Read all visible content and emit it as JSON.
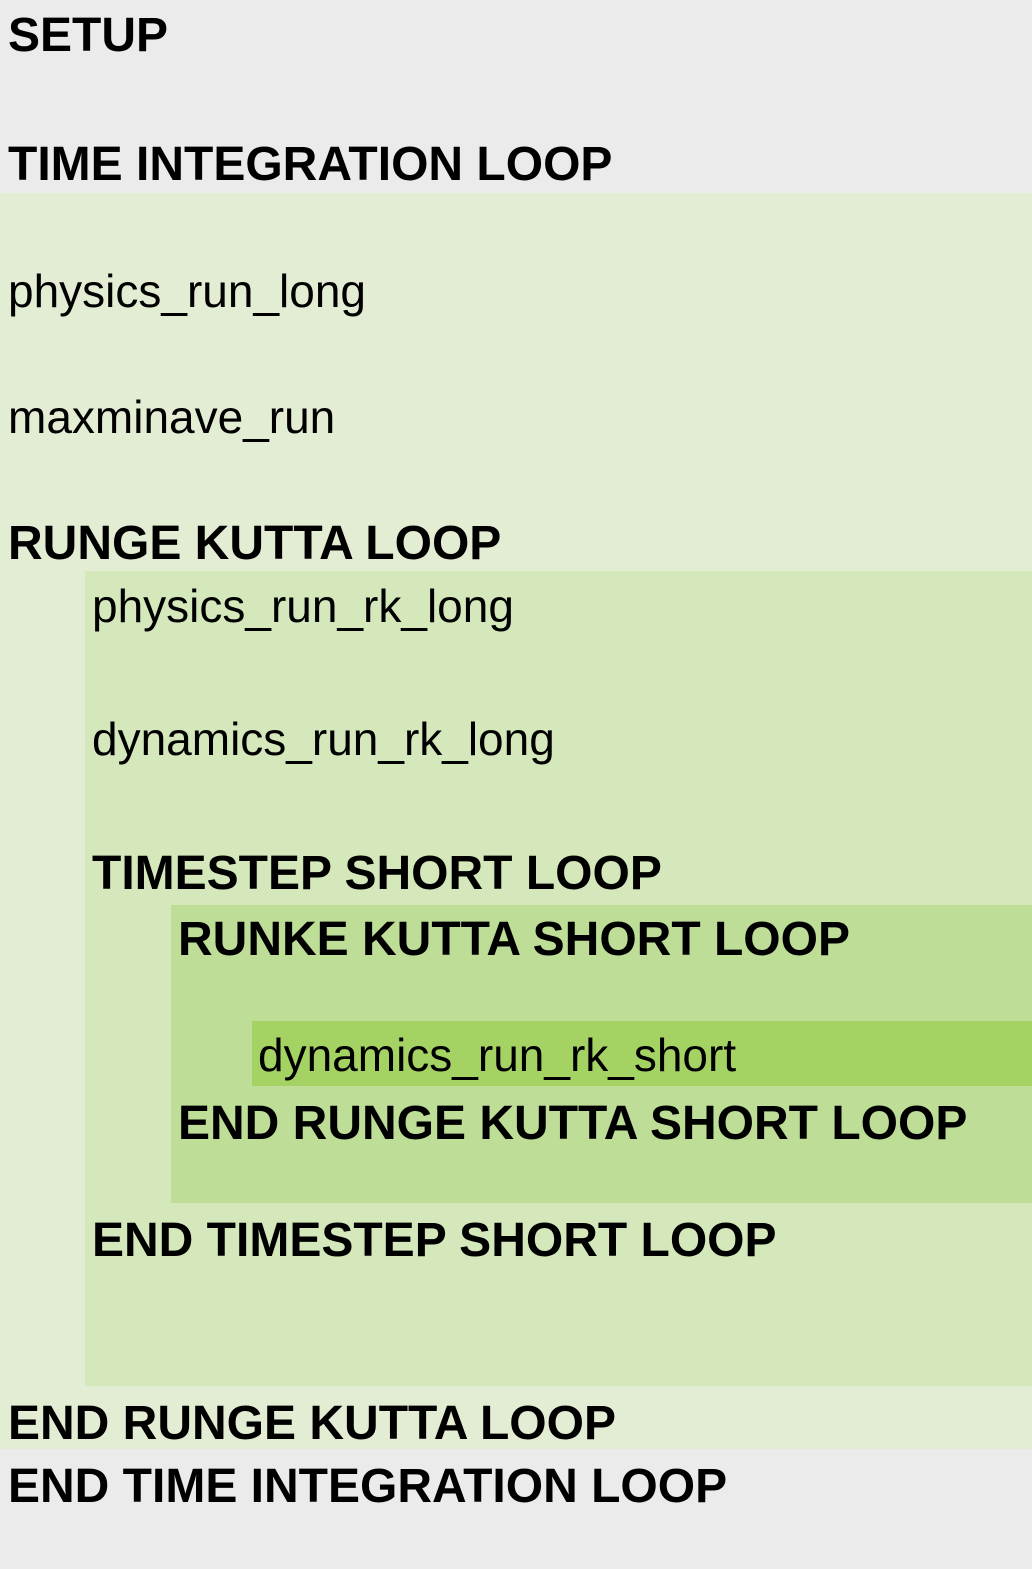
{
  "lines": {
    "setup": "SETUP",
    "time_loop": "TIME INTEGRATION LOOP",
    "physics_run_long": "physics_run_long",
    "maxminave_run": "maxminave_run",
    "rk_loop": "RUNGE KUTTA LOOP",
    "physics_run_rk_long": "physics_run_rk_long",
    "dynamics_run_rk_long": "dynamics_run_rk_long",
    "timestep_short_loop": "TIMESTEP SHORT LOOP",
    "rk_short_loop": "RUNKE KUTTA SHORT LOOP",
    "dynamics_run_rk_short": "dynamics_run_rk_short",
    "end_rk_short_loop": "END RUNGE KUTTA SHORT LOOP",
    "end_timestep_short_loop": "END TIMESTEP SHORT LOOP",
    "end_rk_loop": "END RUNGE KUTTA LOOP",
    "end_time_loop": "END TIME INTEGRATION LOOP"
  },
  "colors": {
    "background": "#ebebeb",
    "level1": "#e2edd4",
    "level2": "#d4e8bb",
    "level3": "#bedd97",
    "level4": "#a5d363"
  }
}
